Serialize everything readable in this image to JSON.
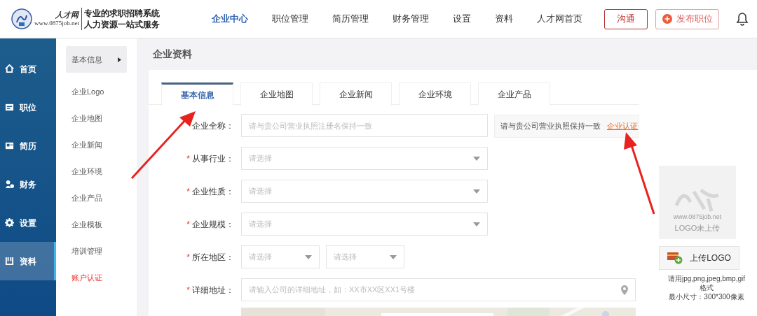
{
  "header": {
    "logo": {
      "name": "人才网",
      "url": "www.0875job.net"
    },
    "slogans": [
      "专业的求职招聘系统",
      "人力资源一站式服务"
    ],
    "nav": [
      {
        "label": "企业中心",
        "selected": true
      },
      {
        "label": "职位管理",
        "selected": false
      },
      {
        "label": "简历管理",
        "selected": false
      },
      {
        "label": "财务管理",
        "selected": false
      },
      {
        "label": "设置",
        "selected": false
      },
      {
        "label": "资料",
        "selected": false
      },
      {
        "label": "人才网首页",
        "selected": false
      }
    ],
    "buttons": [
      {
        "label": "沟通",
        "kind": "chat"
      },
      {
        "label": "发布职位",
        "kind": "publish"
      }
    ]
  },
  "sidebar": {
    "items": [
      {
        "label": "首页",
        "selected": false
      },
      {
        "label": "职位",
        "selected": false
      },
      {
        "label": "简历",
        "selected": false
      },
      {
        "label": "财务",
        "selected": false
      },
      {
        "label": "设置",
        "selected": false
      },
      {
        "label": "资料",
        "selected": true
      }
    ]
  },
  "submenu": {
    "items": [
      {
        "label": "基本信息",
        "selected": true,
        "kind": "link"
      },
      {
        "label": "企业Logo",
        "selected": false,
        "kind": "link"
      },
      {
        "label": "企业地图",
        "selected": false,
        "kind": "link"
      },
      {
        "label": "企业新闻",
        "selected": false,
        "kind": "link"
      },
      {
        "label": "企业环境",
        "selected": false,
        "kind": "link"
      },
      {
        "label": "企业产品",
        "selected": false,
        "kind": "link"
      },
      {
        "label": "企业模板",
        "selected": false,
        "kind": "link"
      },
      {
        "label": "培训管理",
        "selected": false,
        "kind": "link"
      },
      {
        "label": "账户认证",
        "selected": false,
        "kind": "alert"
      }
    ]
  },
  "page_title": "企业资料",
  "tabs": [
    {
      "label": "基本信息",
      "selected": true
    },
    {
      "label": "企业地图",
      "selected": false
    },
    {
      "label": "企业新闻",
      "selected": false
    },
    {
      "label": "企业环境",
      "selected": false
    },
    {
      "label": "企业产品",
      "selected": false
    }
  ],
  "form": {
    "rows": [
      {
        "label": "企业全称：",
        "kind": "input",
        "placeholders": [
          "请与贵公司营业执照注册名保持一致"
        ]
      },
      {
        "label": "从事行业：",
        "marker": "*",
        "kind": "select",
        "placeholders": [
          "请选择"
        ]
      },
      {
        "label": "企业性质：",
        "marker": "*",
        "kind": "select",
        "placeholders": [
          "请选择"
        ]
      },
      {
        "label": "企业规模：",
        "marker": "*",
        "kind": "select",
        "placeholders": [
          "请选择"
        ]
      },
      {
        "label": "所在地区：",
        "marker": "*",
        "kind": "select",
        "placeholders": [
          "请选择",
          "请选择"
        ]
      },
      {
        "label": "详细地址：",
        "marker": "*",
        "kind": "address",
        "placeholders": [
          "请输入公司的详细地址，如：XX市XX区XX1号楼"
        ]
      }
    ],
    "verify": {
      "hint": "请与贵公司营业执照保持一致",
      "link": "企业认证"
    }
  },
  "logo_panel": {
    "placeholder_lines": [
      "www.0875job.net",
      "LOGO未上传"
    ],
    "button": "上传LOGO",
    "hints": [
      "请用jpg,png,jpeg,bmp,gif格式",
      "最小尺寸：300*300像素"
    ]
  }
}
